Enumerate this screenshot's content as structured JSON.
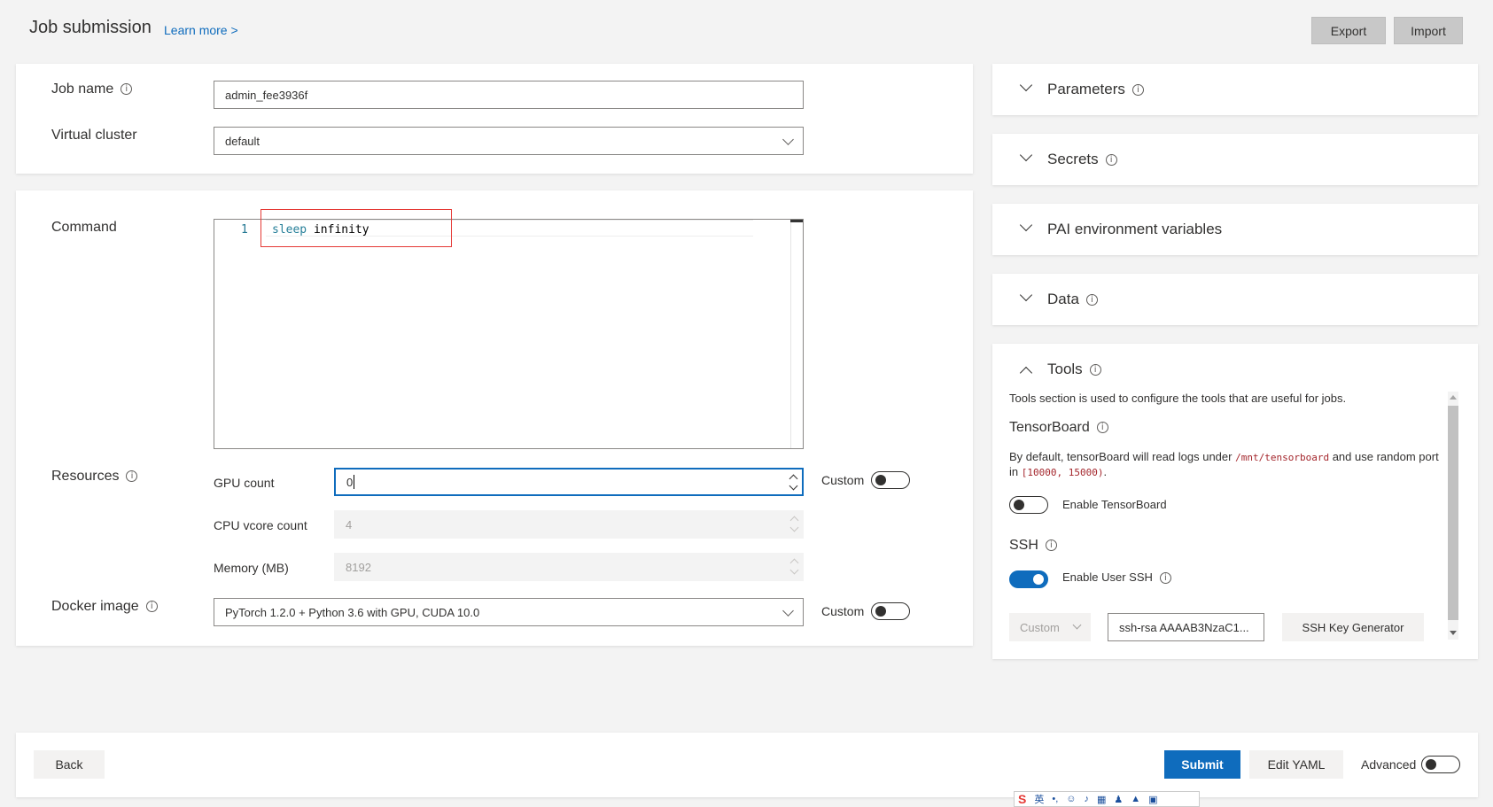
{
  "header": {
    "title": "Job submission",
    "learn_more": "Learn more >",
    "export_label": "Export",
    "import_label": "Import"
  },
  "basic": {
    "job_name_label": "Job name",
    "job_name_value": "admin_fee3936f",
    "virtual_cluster_label": "Virtual cluster",
    "virtual_cluster_value": "default"
  },
  "command": {
    "label": "Command",
    "line_number": "1",
    "keyword": "sleep",
    "rest": " infinity"
  },
  "resources": {
    "label": "Resources",
    "gpu_label": "GPU count",
    "gpu_value": "0",
    "cpu_label": "CPU vcore count",
    "cpu_value": "4",
    "memory_label": "Memory (MB)",
    "memory_value": "8192",
    "custom_label": "Custom"
  },
  "docker": {
    "label": "Docker image",
    "value": "PyTorch 1.2.0 + Python 3.6 with GPU, CUDA 10.0",
    "custom_label": "Custom"
  },
  "panels": {
    "parameters": "Parameters",
    "secrets": "Secrets",
    "pai_env": "PAI environment variables",
    "data": "Data",
    "tools": "Tools"
  },
  "tools": {
    "description": "Tools section is used to configure the tools that are useful for jobs.",
    "tensorboard_title": "TensorBoard",
    "tensorboard_desc_1": "By default, tensorBoard will read logs under",
    "tensorboard_path": "/mnt/tensorboard",
    "tensorboard_desc_2": "and use random",
    "tensorboard_desc_3": "port in",
    "tensorboard_range": "[10000, 15000)",
    "tensorboard_desc_4": ".",
    "enable_tensorboard": "Enable TensorBoard",
    "tensorboard_enabled": false,
    "ssh_title": "SSH",
    "enable_user_ssh": "Enable User SSH",
    "ssh_enabled": true,
    "ssh_key_type": "Custom",
    "ssh_key_value": "ssh-rsa AAAAB3NzaC1...",
    "ssh_key_generator": "SSH Key Generator"
  },
  "footer": {
    "back_label": "Back",
    "submit_label": "Submit",
    "edit_yaml_label": "Edit YAML",
    "advanced_label": "Advanced"
  },
  "ime": {
    "logo": "S",
    "lang": "英"
  },
  "colors": {
    "primary": "#0f6cbd",
    "annotation": "#e53935"
  }
}
